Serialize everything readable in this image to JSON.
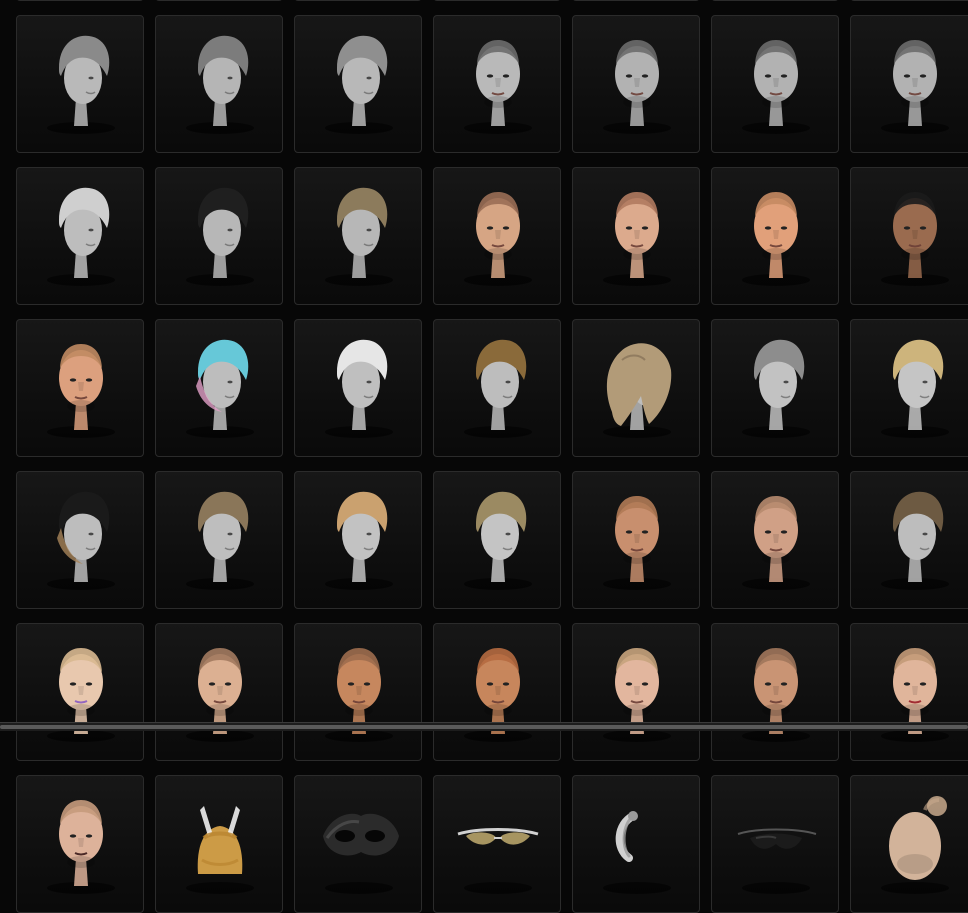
{
  "colors": {
    "background": "#070707",
    "tile": "#121212",
    "tile_border": "#2b2b2b"
  },
  "assets": [
    {
      "kind": "hair-back",
      "hair": "#8a8a8a",
      "skin": "#b9b9b9"
    },
    {
      "kind": "hair-back",
      "hair": "#7c7c7c",
      "skin": "#b5b5b5"
    },
    {
      "kind": "hair-back",
      "hair": "#8f8f8f",
      "skin": "#b8b8b8"
    },
    {
      "kind": "face",
      "hair": "#6b6b6b",
      "skin": "#b9b9b9"
    },
    {
      "kind": "face",
      "hair": "#6b6b6b",
      "skin": "#b2b2b2"
    },
    {
      "kind": "face",
      "hair": "#6b6b6b",
      "skin": "#b2b2b2"
    },
    {
      "kind": "face",
      "hair": "#6b6b6b",
      "skin": "#b2b2b2"
    },
    {
      "kind": "hair",
      "hair": "#cfcfcf",
      "skin": "#bdbdbd"
    },
    {
      "kind": "hair",
      "hair": "#1f1f1f",
      "skin": "#b7b7b7"
    },
    {
      "kind": "hair",
      "hair": "#8c7b5c",
      "skin": "#b7b7b7"
    },
    {
      "kind": "face",
      "hair": "#9a6e55",
      "skin": "#d6a584"
    },
    {
      "kind": "face",
      "hair": "#b07a5f",
      "skin": "#dcaa8d"
    },
    {
      "kind": "face",
      "hair": "#c58a62",
      "skin": "#e1a07a"
    },
    {
      "kind": "face",
      "hair": "#1b1b1b",
      "skin": "#9a6b4f"
    },
    {
      "kind": "face",
      "hair": "#c08a62",
      "skin": "#dca07e"
    },
    {
      "kind": "hair",
      "hair": "#66c8d8",
      "skin": "#bdbdbd",
      "accent": "#e2a0c8"
    },
    {
      "kind": "hair",
      "hair": "#e6e6e6",
      "skin": "#bfbfbf"
    },
    {
      "kind": "hair",
      "hair": "#8a6a3a",
      "skin": "#bdbdbd"
    },
    {
      "kind": "hair-long",
      "hair": "#b29b78",
      "skin": "#bdbdbd"
    },
    {
      "kind": "hair",
      "hair": "#8d8d8d",
      "skin": "#c2c2c2"
    },
    {
      "kind": "hair",
      "hair": "#cdb47c",
      "skin": "#c5c5c5"
    },
    {
      "kind": "hair",
      "hair": "#1a1a1a",
      "skin": "#bdbdbd",
      "accent": "#a8845a"
    },
    {
      "kind": "hair",
      "hair": "#8a7659",
      "skin": "#bebebe"
    },
    {
      "kind": "hair",
      "hair": "#caa16f",
      "skin": "#c2c2c2"
    },
    {
      "kind": "hair",
      "hair": "#9b8a62",
      "skin": "#c4c4c4"
    },
    {
      "kind": "face",
      "hair": "#b07a55",
      "skin": "#c88f6e"
    },
    {
      "kind": "face",
      "hair": "#b68a6e",
      "skin": "#d0a086"
    },
    {
      "kind": "hair",
      "hair": "#6d5a42",
      "skin": "#bdbdbd"
    },
    {
      "kind": "face",
      "hair": "#d8b890",
      "skin": "#e8c8ae",
      "accent": "#8a5bc2"
    },
    {
      "kind": "face",
      "hair": "#a27a5f",
      "skin": "#dcb092"
    },
    {
      "kind": "face",
      "hair": "#9d6d4e",
      "skin": "#c6875e"
    },
    {
      "kind": "face",
      "hair": "#b56a40",
      "skin": "#c7865c"
    },
    {
      "kind": "face",
      "hair": "#c7a37c",
      "skin": "#e2b69e"
    },
    {
      "kind": "face",
      "hair": "#a0765b",
      "skin": "#c99474"
    },
    {
      "kind": "face",
      "hair": "#c39a78",
      "skin": "#e0b59b",
      "accent": "#9a1f28"
    },
    {
      "kind": "face",
      "hair": "#c59a7c",
      "skin": "#ddb29a",
      "accent": "#3a1a1a"
    },
    {
      "kind": "helmet",
      "hair": "#d7a34a",
      "skin": "#d7a34a"
    },
    {
      "kind": "mask",
      "hair": "#2b2b2b",
      "skin": "#5a5a5a"
    },
    {
      "kind": "glasses",
      "hair": "#b8a46a",
      "skin": "#d1d1d1"
    },
    {
      "kind": "headset",
      "hair": "#9a9a9a",
      "skin": "#d0d0d0"
    },
    {
      "kind": "visor",
      "hair": "#1b1b1b",
      "skin": "#555555"
    },
    {
      "kind": "blank-head",
      "hair": "#c8a98c",
      "skin": "#d2b39a"
    }
  ]
}
